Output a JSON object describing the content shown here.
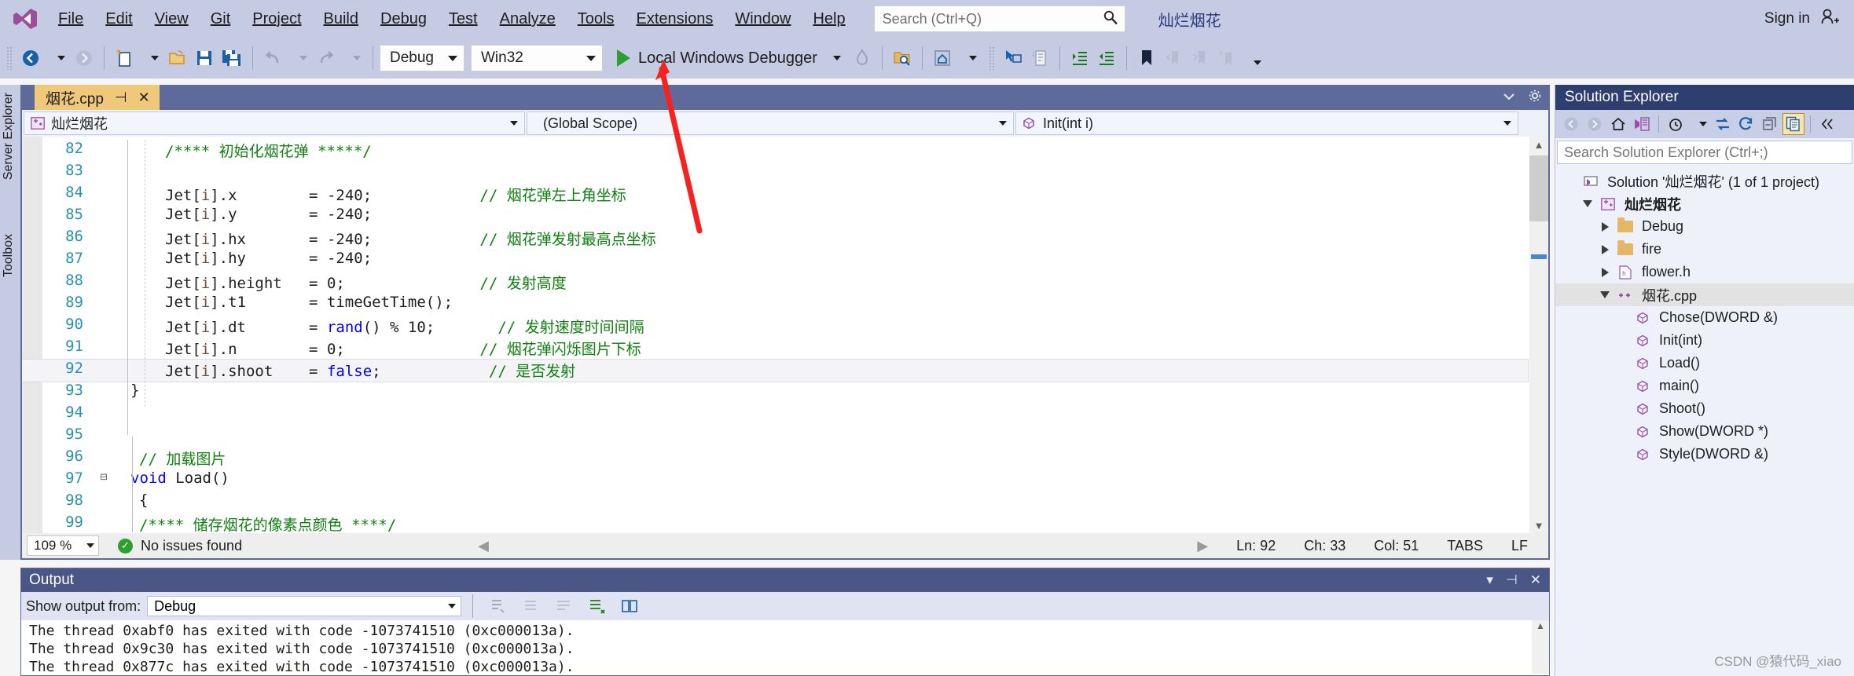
{
  "app": {
    "product": "Visual Studio",
    "project_title": "灿烂烟花",
    "sign_in_label": "Sign in"
  },
  "menubar": {
    "items": [
      {
        "label": "File"
      },
      {
        "label": "Edit"
      },
      {
        "label": "View"
      },
      {
        "label": "Git"
      },
      {
        "label": "Project"
      },
      {
        "label": "Build"
      },
      {
        "label": "Debug"
      },
      {
        "label": "Test"
      },
      {
        "label": "Analyze"
      },
      {
        "label": "Tools"
      },
      {
        "label": "Extensions"
      },
      {
        "label": "Window"
      },
      {
        "label": "Help"
      }
    ],
    "search_placeholder": "Search (Ctrl+Q)",
    "search_value": "",
    "search_icon": "search-icon",
    "signin_icon": "user-add-icon"
  },
  "toolbar": {
    "nav_back_icon": "navigate-back-icon",
    "nav_forward_icon": "navigate-forward-icon",
    "new_item_icon": "new-item-icon",
    "open_file_icon": "open-file-icon",
    "save_icon": "save-icon",
    "save_all_icon": "save-all-icon",
    "undo_icon": "undo-icon",
    "redo_icon": "redo-icon",
    "configuration": "Debug",
    "platform": "Win32",
    "run_label": "Local Windows Debugger",
    "run_icon": "play-icon",
    "hot_reload_icon": "hot-reload-icon",
    "find_in_files_icon": "find-in-files-icon",
    "solution_home_icon": "solution-home-icon",
    "pointer_icon": "pointer-icon",
    "comment_icon": "comment-icon",
    "uncomment_icon": "uncomment-icon",
    "indent_icon": "increase-indent-icon",
    "outdent_icon": "decrease-indent-icon",
    "bookmark_icon": "bookmark-icon",
    "prev_bookmark_icon": "previous-bookmark-icon",
    "next_bookmark_icon": "next-bookmark-icon",
    "clear_bookmark_icon": "clear-bookmarks-icon",
    "overflow_icon": "toolbar-overflow-icon"
  },
  "left_rail": {
    "tabs": [
      "Server Explorer",
      "Toolbox"
    ]
  },
  "editor": {
    "tab": {
      "filename": "烟花.cpp",
      "pin_icon": "pin-icon",
      "close_icon": "close-icon"
    },
    "tab_strip_right": {
      "dropdown_icon": "chevron-down-icon",
      "settings_icon": "gear-icon"
    },
    "navbar": {
      "project_icon": "cpp-project-icon",
      "project": "灿烂烟花",
      "scope": "(Global Scope)",
      "member_icon": "method-icon",
      "member": "Init(int i)"
    },
    "code_lines": [
      {
        "num": "82",
        "fold": "",
        "indent": 6,
        "segments": [
          {
            "t": "/**** 初始化烟花弹 *****/",
            "c": "cmt"
          }
        ]
      },
      {
        "num": "83",
        "fold": "",
        "indent": 0,
        "segments": []
      },
      {
        "num": "84",
        "fold": "",
        "indent": 6,
        "segments": [
          {
            "t": "Jet[",
            "c": ""
          },
          {
            "t": "i",
            "c": "idv"
          },
          {
            "t": "].x        = ",
            "c": ""
          },
          {
            "t": "-240;",
            "c": "num"
          },
          {
            "t": "            ",
            "c": ""
          },
          {
            "t": "// 烟花弹左上角坐标",
            "c": "cmt"
          }
        ]
      },
      {
        "num": "85",
        "fold": "",
        "indent": 6,
        "segments": [
          {
            "t": "Jet[",
            "c": ""
          },
          {
            "t": "i",
            "c": "idv"
          },
          {
            "t": "].y        = ",
            "c": ""
          },
          {
            "t": "-240;",
            "c": "num"
          }
        ]
      },
      {
        "num": "86",
        "fold": "",
        "indent": 6,
        "segments": [
          {
            "t": "Jet[",
            "c": ""
          },
          {
            "t": "i",
            "c": "idv"
          },
          {
            "t": "].hx       = ",
            "c": ""
          },
          {
            "t": "-240;",
            "c": "num"
          },
          {
            "t": "            ",
            "c": ""
          },
          {
            "t": "// 烟花弹发射最高点坐标",
            "c": "cmt"
          }
        ]
      },
      {
        "num": "87",
        "fold": "",
        "indent": 6,
        "segments": [
          {
            "t": "Jet[",
            "c": ""
          },
          {
            "t": "i",
            "c": "idv"
          },
          {
            "t": "].hy       = ",
            "c": ""
          },
          {
            "t": "-240;",
            "c": "num"
          }
        ]
      },
      {
        "num": "88",
        "fold": "",
        "indent": 6,
        "segments": [
          {
            "t": "Jet[",
            "c": ""
          },
          {
            "t": "i",
            "c": "idv"
          },
          {
            "t": "].height   = ",
            "c": ""
          },
          {
            "t": "0;",
            "c": "num"
          },
          {
            "t": "               ",
            "c": ""
          },
          {
            "t": "// 发射高度",
            "c": "cmt"
          }
        ]
      },
      {
        "num": "89",
        "fold": "",
        "indent": 6,
        "segments": [
          {
            "t": "Jet[",
            "c": ""
          },
          {
            "t": "i",
            "c": "idv"
          },
          {
            "t": "].t1       = timeGetTime();",
            "c": ""
          }
        ]
      },
      {
        "num": "90",
        "fold": "",
        "indent": 6,
        "segments": [
          {
            "t": "Jet[",
            "c": ""
          },
          {
            "t": "i",
            "c": "idv"
          },
          {
            "t": "].dt       = ",
            "c": ""
          },
          {
            "t": "rand",
            "c": "kw"
          },
          {
            "t": "() % ",
            "c": ""
          },
          {
            "t": "10;",
            "c": "num"
          },
          {
            "t": "       ",
            "c": ""
          },
          {
            "t": "// 发射速度时间间隔",
            "c": "cmt"
          }
        ]
      },
      {
        "num": "91",
        "fold": "",
        "indent": 6,
        "segments": [
          {
            "t": "Jet[",
            "c": ""
          },
          {
            "t": "i",
            "c": "idv"
          },
          {
            "t": "].n        = ",
            "c": ""
          },
          {
            "t": "0;",
            "c": "num"
          },
          {
            "t": "               ",
            "c": ""
          },
          {
            "t": "// 烟花弹闪烁图片下标",
            "c": "cmt"
          }
        ]
      },
      {
        "num": "92",
        "fold": "",
        "indent": 6,
        "current": true,
        "segments": [
          {
            "t": "Jet[",
            "c": ""
          },
          {
            "t": "i",
            "c": "idv"
          },
          {
            "t": "].shoot    = ",
            "c": ""
          },
          {
            "t": "false",
            "c": "kw"
          },
          {
            "t": ";",
            "c": ""
          },
          {
            "t": "            ",
            "c": ""
          },
          {
            "t": "// 是否发射",
            "c": "cmt"
          }
        ]
      },
      {
        "num": "93",
        "fold": "",
        "indent": 2,
        "segments": [
          {
            "t": "}",
            "c": ""
          }
        ]
      },
      {
        "num": "94",
        "fold": "",
        "indent": 0,
        "segments": []
      },
      {
        "num": "95",
        "fold": "",
        "indent": 0,
        "segments": []
      },
      {
        "num": "96",
        "fold": "",
        "indent": 3,
        "segments": [
          {
            "t": "// 加载图片",
            "c": "cmt"
          }
        ]
      },
      {
        "num": "97",
        "fold": "-",
        "indent": 2,
        "segments": [
          {
            "t": "void",
            "c": "kw"
          },
          {
            "t": " Load()",
            "c": ""
          }
        ]
      },
      {
        "num": "98",
        "fold": "",
        "indent": 3,
        "segments": [
          {
            "t": "{",
            "c": ""
          }
        ]
      },
      {
        "num": "99",
        "fold": "",
        "indent": 3,
        "segments": [
          {
            "t": "/**** 储存烟花的像素点颜色 ****/",
            "c": "cmt"
          }
        ]
      }
    ],
    "status": {
      "zoom": "109 %",
      "issues_icon": "check-circle-icon",
      "issues": "No issues found",
      "prev_icon": "scroll-left-icon",
      "next_icon": "scroll-right-icon",
      "ln_label": "Ln: 92",
      "ch_label": "Ch: 33",
      "col_label": "Col: 51",
      "tabs_label": "TABS",
      "eol_label": "LF"
    }
  },
  "output": {
    "title": "Output",
    "dropdown_icon": "chevron-down-icon",
    "pin_icon": "pin-icon",
    "close_icon": "close-icon",
    "filter_label": "Show output from:",
    "filter_value": "Debug",
    "tb_icons": [
      "find-message-icon",
      "clear-all-icon",
      "toggle-wordwrap-icon",
      "clear-pane-icon",
      "toggle-output-icon"
    ],
    "lines": [
      "The thread 0xabf0 has exited with code -1073741510 (0xc000013a).",
      "The thread 0x9c30 has exited with code -1073741510 (0xc000013a).",
      "The thread 0x877c has exited with code -1073741510 (0xc000013a)."
    ]
  },
  "solution_explorer": {
    "title": "Solution Explorer",
    "toolbar_icons": [
      "back-icon",
      "forward-icon",
      "home-icon",
      "solution-view-icon",
      "pending-changes-icon",
      "sync-icon",
      "refresh-icon",
      "collapse-all-icon",
      "properties-window-icon",
      "collapse-pane-icon"
    ],
    "search_placeholder": "Search Solution Explorer (Ctrl+;)",
    "search_value": "",
    "tree": [
      {
        "depth": 0,
        "twisty": "",
        "icon": "solution-icon",
        "label": "Solution '灿烂烟花' (1 of 1 project)"
      },
      {
        "depth": 1,
        "twisty": "down",
        "icon": "cpp-project-icon",
        "label": "灿烂烟花",
        "bold": true
      },
      {
        "depth": 2,
        "twisty": "right",
        "icon": "folder-icon",
        "label": "Debug"
      },
      {
        "depth": 2,
        "twisty": "right",
        "icon": "folder-icon",
        "label": "fire"
      },
      {
        "depth": 2,
        "twisty": "right",
        "icon": "header-file-icon",
        "label": "flower.h"
      },
      {
        "depth": 2,
        "twisty": "down",
        "icon": "cpp-file-icon",
        "label": "烟花.cpp",
        "selected": true
      },
      {
        "depth": 3,
        "twisty": "",
        "icon": "method-icon",
        "label": "Chose(DWORD &)"
      },
      {
        "depth": 3,
        "twisty": "",
        "icon": "method-icon",
        "label": "Init(int)"
      },
      {
        "depth": 3,
        "twisty": "",
        "icon": "method-icon",
        "label": "Load()"
      },
      {
        "depth": 3,
        "twisty": "",
        "icon": "method-icon",
        "label": "main()"
      },
      {
        "depth": 3,
        "twisty": "",
        "icon": "method-icon",
        "label": "Shoot()"
      },
      {
        "depth": 3,
        "twisty": "",
        "icon": "method-icon",
        "label": "Show(DWORD *)"
      },
      {
        "depth": 3,
        "twisty": "",
        "icon": "method-icon",
        "label": "Style(DWORD &)"
      }
    ]
  },
  "annotation": {
    "arrow_color": "#f5231f",
    "arrow_name": "red-annotation-arrow"
  },
  "watermark": {
    "text": "CSDN @猿代码_xiao"
  },
  "colors": {
    "chrome": "#c5cbe2",
    "accent_blue": "#2e3e6e",
    "tab_active": "#f0c87a",
    "comment_green": "#108010",
    "keyword_blue": "#0000ff",
    "linenum_blue": "#2b91af"
  }
}
